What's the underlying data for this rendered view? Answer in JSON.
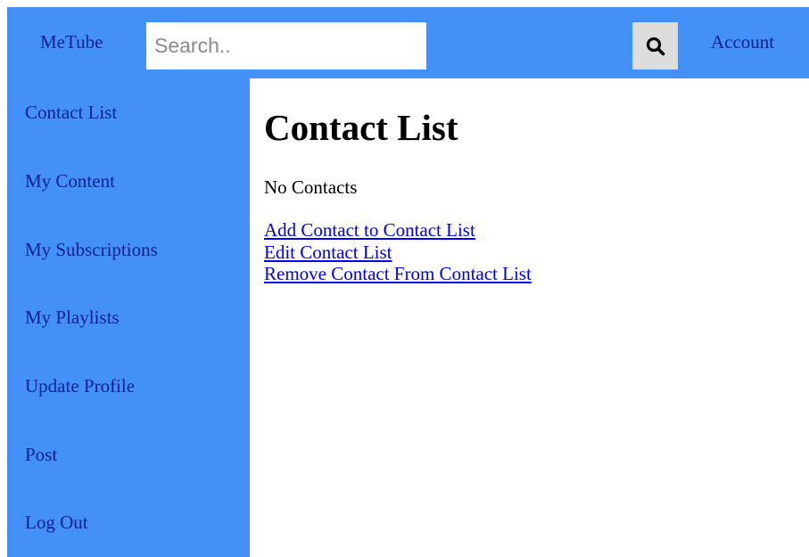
{
  "header": {
    "brand": "MeTube",
    "search_placeholder": "Search..",
    "search_icon": "magnifier-icon",
    "account_label": "Account"
  },
  "sidebar": {
    "items": [
      {
        "label": "Contact List"
      },
      {
        "label": "My Content"
      },
      {
        "label": "My Subscriptions"
      },
      {
        "label": "My Playlists"
      },
      {
        "label": "Update Profile"
      },
      {
        "label": "Post"
      },
      {
        "label": "Log Out"
      }
    ]
  },
  "main": {
    "title": "Contact List",
    "empty_text": "No Contacts",
    "links": [
      {
        "label": "Add Contact to Contact List"
      },
      {
        "label": "Edit Contact List"
      },
      {
        "label": "Remove Contact From Contact List"
      }
    ]
  },
  "colors": {
    "accent": "#4391f7",
    "nav_text": "#0a1f8f",
    "link": "#0000ee",
    "search_button_bg": "#dddddd"
  }
}
